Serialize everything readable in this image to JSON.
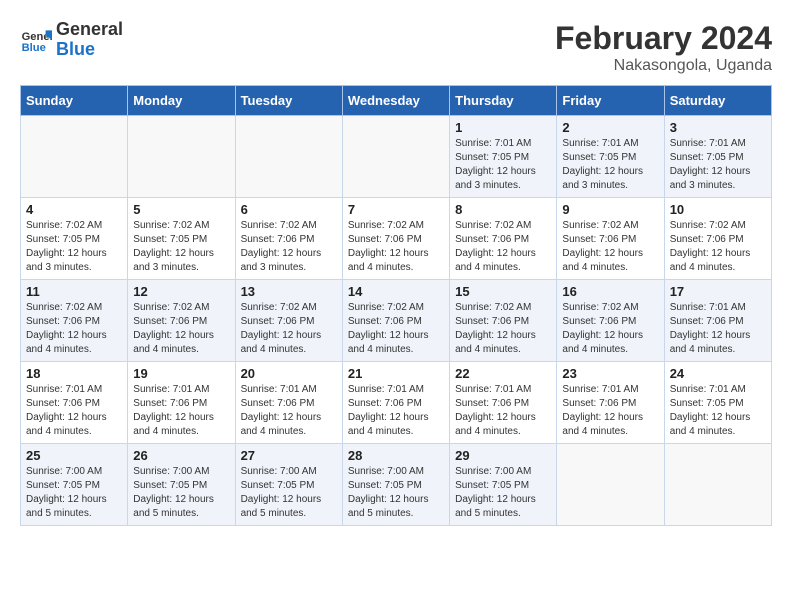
{
  "header": {
    "logo_line1": "General",
    "logo_line2": "Blue",
    "title": "February 2024",
    "subtitle": "Nakasongola, Uganda"
  },
  "days_of_week": [
    "Sunday",
    "Monday",
    "Tuesday",
    "Wednesday",
    "Thursday",
    "Friday",
    "Saturday"
  ],
  "weeks": [
    [
      {
        "day": "",
        "info": ""
      },
      {
        "day": "",
        "info": ""
      },
      {
        "day": "",
        "info": ""
      },
      {
        "day": "",
        "info": ""
      },
      {
        "day": "1",
        "info": "Sunrise: 7:01 AM\nSunset: 7:05 PM\nDaylight: 12 hours\nand 3 minutes."
      },
      {
        "day": "2",
        "info": "Sunrise: 7:01 AM\nSunset: 7:05 PM\nDaylight: 12 hours\nand 3 minutes."
      },
      {
        "day": "3",
        "info": "Sunrise: 7:01 AM\nSunset: 7:05 PM\nDaylight: 12 hours\nand 3 minutes."
      }
    ],
    [
      {
        "day": "4",
        "info": "Sunrise: 7:02 AM\nSunset: 7:05 PM\nDaylight: 12 hours\nand 3 minutes."
      },
      {
        "day": "5",
        "info": "Sunrise: 7:02 AM\nSunset: 7:05 PM\nDaylight: 12 hours\nand 3 minutes."
      },
      {
        "day": "6",
        "info": "Sunrise: 7:02 AM\nSunset: 7:06 PM\nDaylight: 12 hours\nand 3 minutes."
      },
      {
        "day": "7",
        "info": "Sunrise: 7:02 AM\nSunset: 7:06 PM\nDaylight: 12 hours\nand 4 minutes."
      },
      {
        "day": "8",
        "info": "Sunrise: 7:02 AM\nSunset: 7:06 PM\nDaylight: 12 hours\nand 4 minutes."
      },
      {
        "day": "9",
        "info": "Sunrise: 7:02 AM\nSunset: 7:06 PM\nDaylight: 12 hours\nand 4 minutes."
      },
      {
        "day": "10",
        "info": "Sunrise: 7:02 AM\nSunset: 7:06 PM\nDaylight: 12 hours\nand 4 minutes."
      }
    ],
    [
      {
        "day": "11",
        "info": "Sunrise: 7:02 AM\nSunset: 7:06 PM\nDaylight: 12 hours\nand 4 minutes."
      },
      {
        "day": "12",
        "info": "Sunrise: 7:02 AM\nSunset: 7:06 PM\nDaylight: 12 hours\nand 4 minutes."
      },
      {
        "day": "13",
        "info": "Sunrise: 7:02 AM\nSunset: 7:06 PM\nDaylight: 12 hours\nand 4 minutes."
      },
      {
        "day": "14",
        "info": "Sunrise: 7:02 AM\nSunset: 7:06 PM\nDaylight: 12 hours\nand 4 minutes."
      },
      {
        "day": "15",
        "info": "Sunrise: 7:02 AM\nSunset: 7:06 PM\nDaylight: 12 hours\nand 4 minutes."
      },
      {
        "day": "16",
        "info": "Sunrise: 7:02 AM\nSunset: 7:06 PM\nDaylight: 12 hours\nand 4 minutes."
      },
      {
        "day": "17",
        "info": "Sunrise: 7:01 AM\nSunset: 7:06 PM\nDaylight: 12 hours\nand 4 minutes."
      }
    ],
    [
      {
        "day": "18",
        "info": "Sunrise: 7:01 AM\nSunset: 7:06 PM\nDaylight: 12 hours\nand 4 minutes."
      },
      {
        "day": "19",
        "info": "Sunrise: 7:01 AM\nSunset: 7:06 PM\nDaylight: 12 hours\nand 4 minutes."
      },
      {
        "day": "20",
        "info": "Sunrise: 7:01 AM\nSunset: 7:06 PM\nDaylight: 12 hours\nand 4 minutes."
      },
      {
        "day": "21",
        "info": "Sunrise: 7:01 AM\nSunset: 7:06 PM\nDaylight: 12 hours\nand 4 minutes."
      },
      {
        "day": "22",
        "info": "Sunrise: 7:01 AM\nSunset: 7:06 PM\nDaylight: 12 hours\nand 4 minutes."
      },
      {
        "day": "23",
        "info": "Sunrise: 7:01 AM\nSunset: 7:06 PM\nDaylight: 12 hours\nand 4 minutes."
      },
      {
        "day": "24",
        "info": "Sunrise: 7:01 AM\nSunset: 7:05 PM\nDaylight: 12 hours\nand 4 minutes."
      }
    ],
    [
      {
        "day": "25",
        "info": "Sunrise: 7:00 AM\nSunset: 7:05 PM\nDaylight: 12 hours\nand 5 minutes."
      },
      {
        "day": "26",
        "info": "Sunrise: 7:00 AM\nSunset: 7:05 PM\nDaylight: 12 hours\nand 5 minutes."
      },
      {
        "day": "27",
        "info": "Sunrise: 7:00 AM\nSunset: 7:05 PM\nDaylight: 12 hours\nand 5 minutes."
      },
      {
        "day": "28",
        "info": "Sunrise: 7:00 AM\nSunset: 7:05 PM\nDaylight: 12 hours\nand 5 minutes."
      },
      {
        "day": "29",
        "info": "Sunrise: 7:00 AM\nSunset: 7:05 PM\nDaylight: 12 hours\nand 5 minutes."
      },
      {
        "day": "",
        "info": ""
      },
      {
        "day": "",
        "info": ""
      }
    ]
  ]
}
